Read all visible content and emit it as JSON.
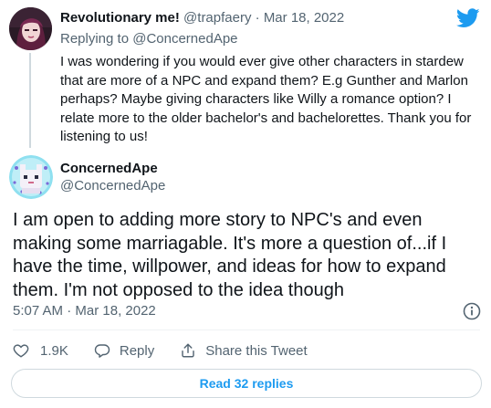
{
  "parent_tweet": {
    "display_name": "Revolutionary me!",
    "handle": "@trapfaery",
    "separator": "·",
    "date": "Mar 18, 2022",
    "replying_prefix": "Replying to",
    "replying_to": "@ConcernedApe",
    "text": "I was wondering if you would ever give other characters in stardew that are more of a NPC and expand them? E.g Gunther and Marlon perhaps? Maybe giving characters like Willy a romance option? I relate more to the older bachelor's and bachelorettes. Thank you for listening to us!"
  },
  "main_tweet": {
    "display_name": "ConcernedApe",
    "handle": "@ConcernedApe",
    "text": "I am open to adding more story to NPC's and even making some marriagable. It's more a question of...if I have the time, willpower, and ideas for how to expand them. I'm not opposed to the idea though",
    "time": "5:07 AM",
    "separator": "·",
    "date": "Mar 18, 2022"
  },
  "actions": {
    "like_count": "1.9K",
    "reply_label": "Reply",
    "share_label": "Share this Tweet"
  },
  "read_replies_label": "Read 32 replies",
  "icons": {
    "brand": "twitter-bird-icon",
    "info": "info-icon",
    "like": "heart-icon",
    "reply": "speech-bubble-icon",
    "share": "share-icon"
  },
  "colors": {
    "brand_blue": "#1d9bf0",
    "secondary_text": "#536471",
    "primary_text": "#0f1419",
    "border": "#cfd9de"
  }
}
